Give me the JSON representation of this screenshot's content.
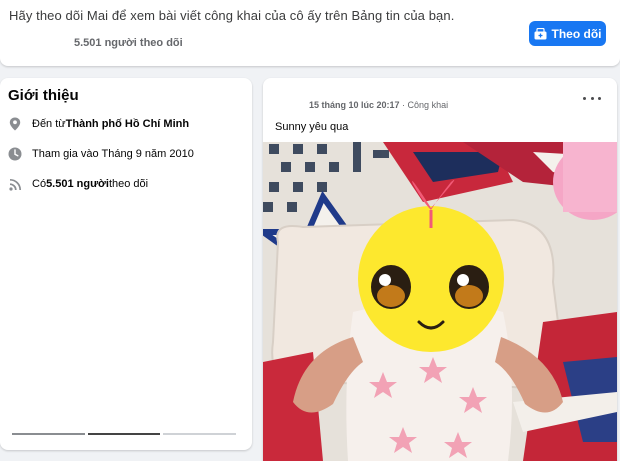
{
  "follow_banner": {
    "message": "Hãy theo dõi Mai để xem bài viết công khai của cô ấy trên Bảng tin của bạn.",
    "followers": "5.501 người theo dõi",
    "button_label": "Theo dõi",
    "button_icon": "follow-icon",
    "accent_color": "#1877f2"
  },
  "intro": {
    "title": "Giới thiệu",
    "rows": [
      {
        "icon": "location-pin-icon",
        "prefix": "Đến từ ",
        "bold": "Thành phố Hồ Chí Minh",
        "suffix": ""
      },
      {
        "icon": "clock-icon",
        "prefix": "Tham gia vào Tháng 9 năm 2010",
        "bold": "",
        "suffix": ""
      },
      {
        "icon": "rss-feed-icon",
        "prefix": "Có ",
        "bold": "5.501 người",
        "suffix": " theo dõi"
      }
    ]
  },
  "post": {
    "date": "15 tháng 10 lúc 20:17",
    "separator": " · ",
    "privacy": "Công khai",
    "more_icon": "more-options-icon",
    "text": "Sunny yêu qua"
  }
}
